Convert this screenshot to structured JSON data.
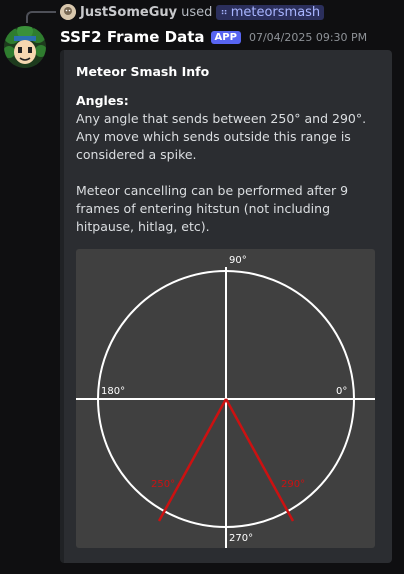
{
  "reply": {
    "username": "JustSomeGuy",
    "used_text": "used",
    "command": "meteorsmash"
  },
  "message": {
    "bot_name": "SSF2 Frame Data",
    "badge": "APP",
    "timestamp": "07/04/2025 09:30 PM"
  },
  "embed": {
    "title": "Meteor Smash Info",
    "angles_heading": "Angles:",
    "angles_line1": "Any angle that sends between 250° and 290°.",
    "angles_line2": "Any move which sends outside this range is considered a spike.",
    "cancel_text": "Meteor cancelling can be performed after 9 frames of entering hitstun (not including hitpause, hitlag, etc).",
    "diagram": {
      "label_90": "90°",
      "label_180": "180°",
      "label_0": "0°",
      "label_270": "270°",
      "label_250": "250°",
      "label_290": "290°",
      "line_color": "#cc1111"
    }
  },
  "colors": {
    "accent": "#5865f2",
    "embed_bg": "#2b2d31",
    "diagram_bg": "#404040"
  }
}
